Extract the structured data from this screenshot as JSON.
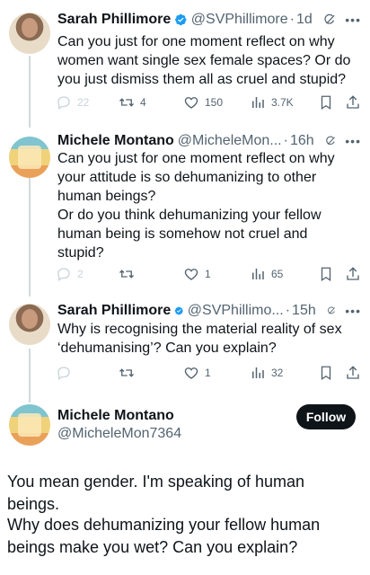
{
  "tweets": [
    {
      "name": "Sarah Phillimore",
      "handle": "@SVPhillimore",
      "time": "1d",
      "text": "Can you just for one moment reflect on why women want single sex female spaces? Or do you just dismiss them all as cruel and stupid?",
      "replies": "22",
      "retweets": "4",
      "likes": "150",
      "views": "3.7K"
    },
    {
      "name": "Michele Montano",
      "handle": "@MicheleMon...",
      "time": "16h",
      "text": "Can you just for one moment reflect on why your attitude is so dehumanizing to other human beings?\nOr do you think dehumanizing your fellow human being is somehow not cruel and stupid?",
      "replies": "2",
      "retweets": "",
      "likes": "1",
      "views": "65"
    },
    {
      "name": "Sarah Phillimore",
      "handle": "@SVPhillimo...",
      "time": "15h",
      "text": "Why is recognising the material reality of sex ‘dehumanising’? Can you explain?",
      "replies": "",
      "retweets": "",
      "likes": "1",
      "views": "32"
    }
  ],
  "main_tweet": {
    "name": "Michele Montano",
    "handle": "@MicheleMon7364",
    "follow_label": "Follow",
    "text_line1": "You mean gender. I'm speaking of human beings.",
    "text_line2": "Why does dehumanizing your fellow human beings make you wet? Can you explain?"
  },
  "colors": {
    "text": "#0f1419",
    "secondary": "#536471",
    "verified": "#1d9bf0",
    "thread_line": "#cfd9de"
  },
  "icons": [
    "verified-badge-icon",
    "grok-icon",
    "more-icon",
    "reply-icon",
    "retweet-icon",
    "like-icon",
    "views-icon",
    "bookmark-icon",
    "share-icon"
  ]
}
